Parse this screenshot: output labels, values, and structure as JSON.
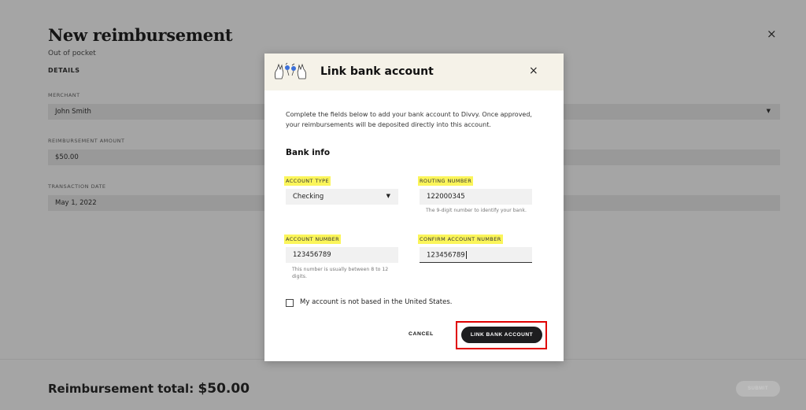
{
  "background": {
    "title": "New reimbursement",
    "subtitle": "Out of pocket",
    "section": "DETAILS",
    "merchant_label": "MERCHANT",
    "merchant_value": "John Smith",
    "amount_label": "REIMBURSEMENT AMOUNT",
    "amount_value": "$50.00",
    "date_label": "TRANSACTION DATE",
    "date_value": "May 1, 2022",
    "close_icon": "×",
    "dropdown_icon": "▼",
    "total_label": "Reimbursement total:",
    "total_value": "$50.00",
    "submit_label": "SUBMIT"
  },
  "modal": {
    "title": "Link bank account",
    "close_icon": "×",
    "intro": "Complete the fields below to add your bank account to Divvy. Once approved, your reimbursements will be deposited directly into this account.",
    "section_title": "Bank info",
    "account_type": {
      "label": "ACCOUNT TYPE",
      "value": "Checking",
      "dropdown_icon": "▼"
    },
    "routing_number": {
      "label": "ROUTING NUMBER",
      "value": "122000345",
      "hint": "The 9-digit number to identify your bank."
    },
    "account_number": {
      "label": "ACCOUNT NUMBER",
      "value": "123456789",
      "hint": "This number is usually between 8 to 12 digits."
    },
    "confirm_account_number": {
      "label": "CONFIRM ACCOUNT NUMBER",
      "value": "123456789"
    },
    "checkbox_label": "My account is not based in the United States.",
    "checkbox_checked": false,
    "cancel_label": "CANCEL",
    "submit_label": "LINK BANK ACCOUNT"
  },
  "colors": {
    "header_bg": "#f5f2e8",
    "label_highlight": "#fbf55a",
    "primary_button": "#1d1d1f",
    "annotation_box": "#e00000",
    "overlay": "#a6a6a6"
  }
}
